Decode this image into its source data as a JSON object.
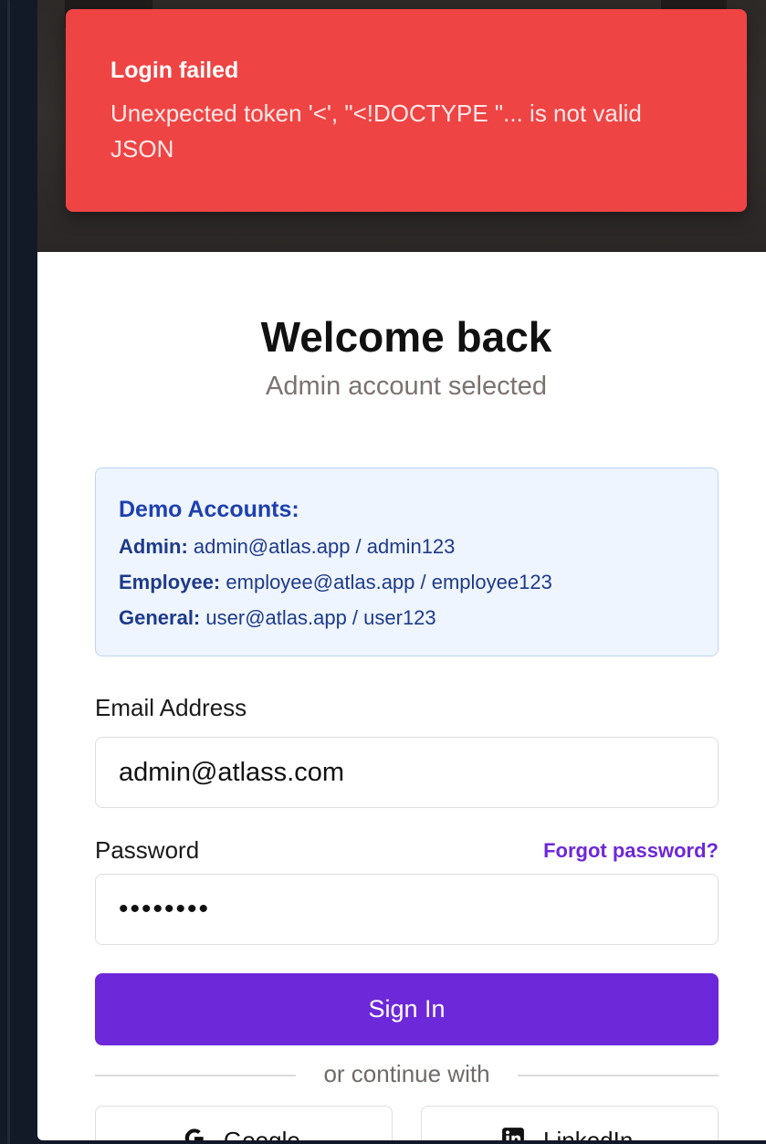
{
  "toast": {
    "title": "Login failed",
    "message": "Unexpected token '<', \"<!DOCTYPE \"... is not valid JSON"
  },
  "header": {
    "title": "Welcome back",
    "subtitle": "Admin account selected"
  },
  "demo_accounts": {
    "title": "Demo Accounts:",
    "items": [
      {
        "role": "Admin:",
        "credentials": "admin@atlas.app / admin123"
      },
      {
        "role": "Employee:",
        "credentials": "employee@atlas.app / employee123"
      },
      {
        "role": "General:",
        "credentials": "user@atlas.app / user123"
      }
    ]
  },
  "form": {
    "email_label": "Email Address",
    "email_value": "admin@atlass.com",
    "password_label": "Password",
    "forgot_label": "Forgot password?",
    "password_value": "••••••••",
    "submit_label": "Sign In",
    "divider_text": "or continue with"
  },
  "social": {
    "google_label": "Google",
    "linkedin_label": "LinkedIn"
  },
  "colors": {
    "toast_bg": "#ef4444",
    "accent": "#6d28d9",
    "demo_bg": "#eef5fe"
  }
}
